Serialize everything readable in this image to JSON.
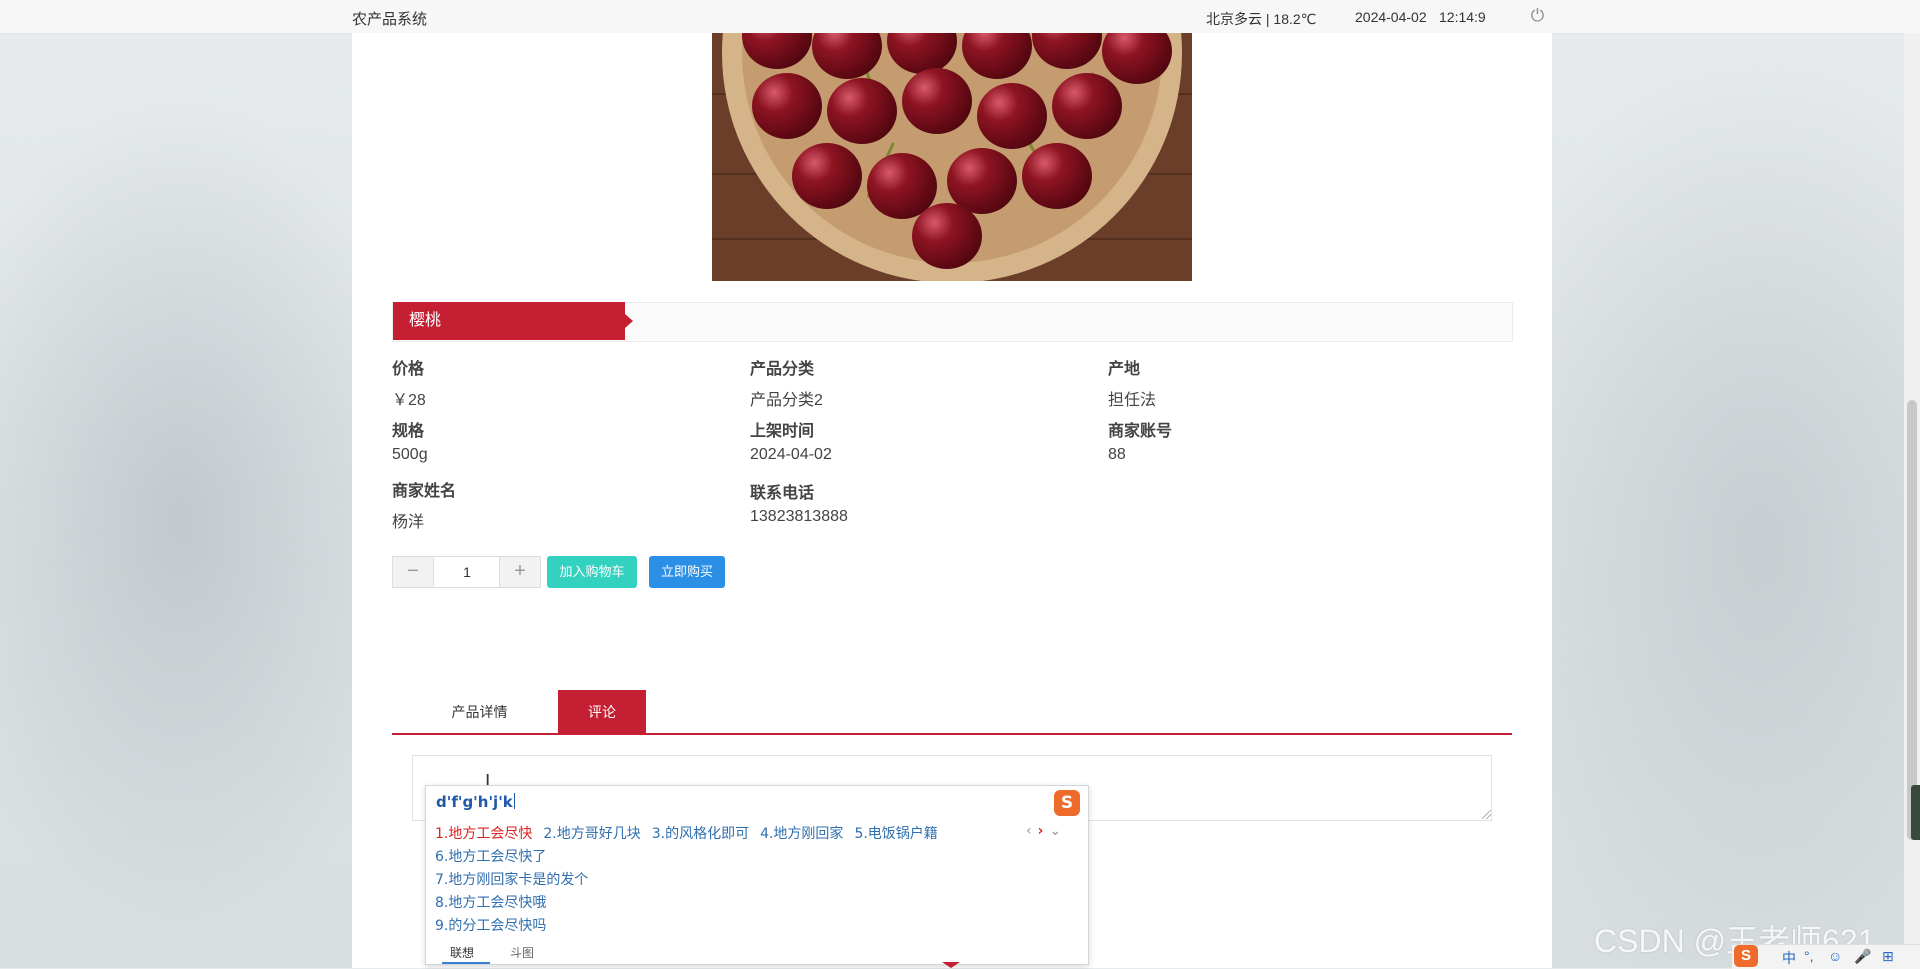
{
  "topbar": {
    "system_name": "农产品系统",
    "weather": "北京多云 | 18.2℃",
    "date": "2024-04-02",
    "time": "12:14:9",
    "power_icon": "power-icon"
  },
  "product": {
    "name": "樱桃",
    "fields": {
      "price_label": "价格",
      "price_value": "￥28",
      "category_label": "产品分类",
      "category_value": "产品分类2",
      "origin_label": "产地",
      "origin_value": "担任法",
      "spec_label": "规格",
      "spec_value": "500g",
      "listed_label": "上架时间",
      "listed_value": "2024-04-02",
      "merchant_account_label": "商家账号",
      "merchant_account_value": "88",
      "merchant_name_label": "商家姓名",
      "merchant_name_value": "杨洋",
      "phone_label": "联系电话",
      "phone_value": "13823813888"
    },
    "quantity": "1",
    "minus_symbol": "−",
    "plus_symbol": "+",
    "add_to_cart": "加入购物车",
    "buy_now": "立即购买"
  },
  "tabs": {
    "detail": "产品详情",
    "comment": "评论",
    "active": "comment"
  },
  "ime": {
    "composition": "d'f'g'h'j'k",
    "logo": "S",
    "row1": [
      "1.地方工会尽快",
      "2.地方哥好几块",
      "3.的风格化即可",
      "4.地方刚回家",
      "5.电饭锅户籍"
    ],
    "more": [
      "6.地方工会尽快了",
      "7.地方刚回家卡是的发个",
      "8.地方工会尽快哦",
      "9.的分工会尽快吗"
    ],
    "nav_prev": "‹",
    "nav_next": "›",
    "nav_expand": "⌄",
    "footer_tab1": "联想",
    "footer_tab2": "斗图"
  },
  "watermark": "CSDN @王老师621",
  "tray": {
    "logo": "S",
    "icons": [
      "中",
      "°,",
      "☺",
      "🎤",
      "⊞"
    ]
  },
  "colors": {
    "accent": "#c41f33",
    "cart_button": "#33d1c0",
    "buy_button": "#2b8fe6"
  }
}
